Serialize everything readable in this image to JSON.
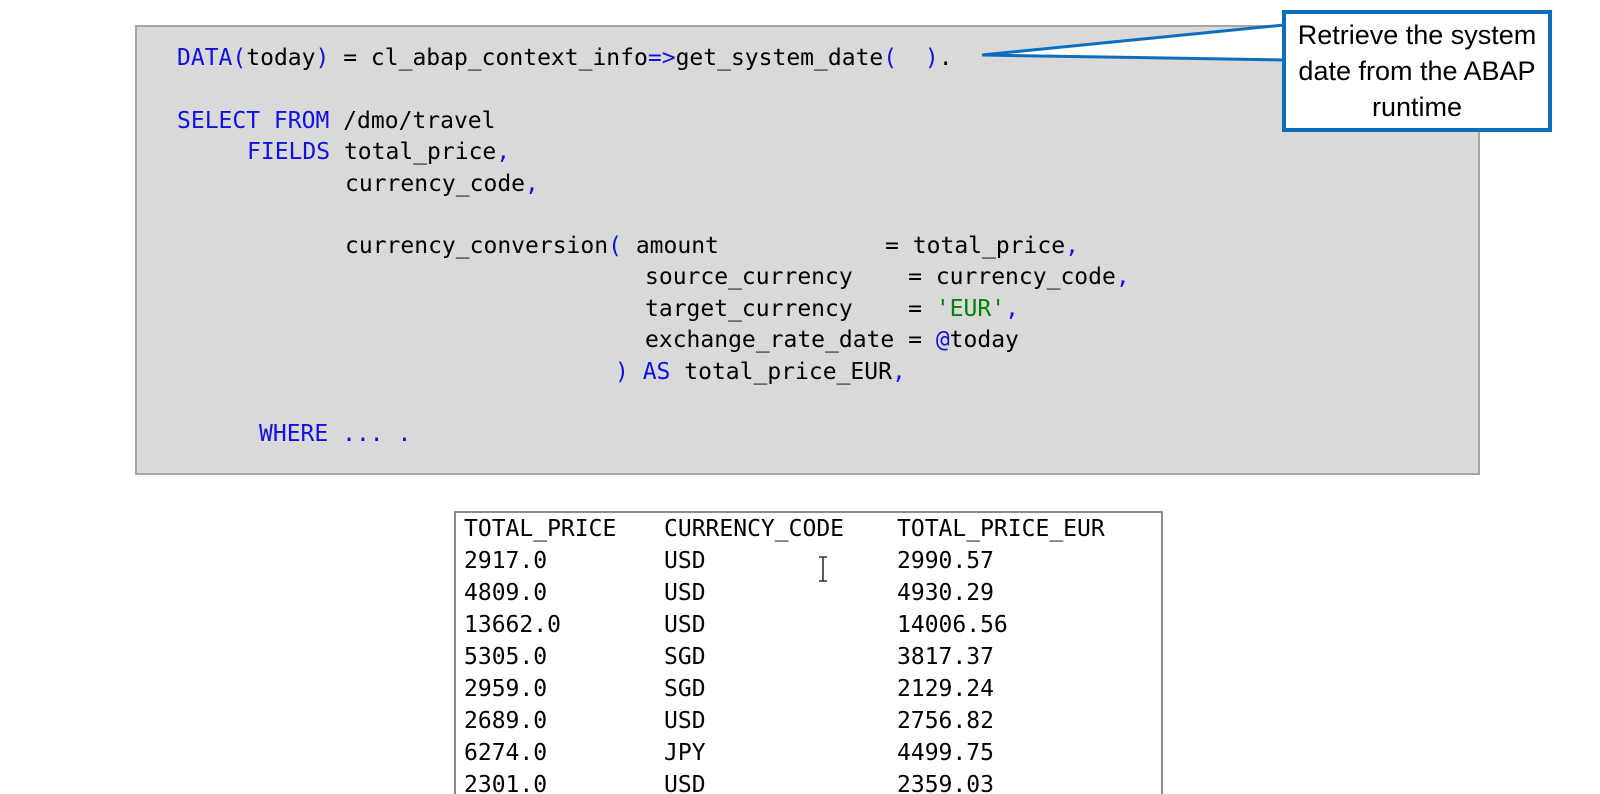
{
  "code": {
    "line_data": {
      "kw_data": "DATA(",
      "var_today": "today",
      "rest": ") = cl_abap_context_info=>get_system_date( ).",
      "call_open_kw": "",
      "call_close": ""
    },
    "line_select": {
      "kw": "SELECT FROM",
      "text": " /dmo/travel"
    },
    "line_fields": {
      "kw": "FIELDS",
      "text": " total_price",
      "comma": ","
    },
    "line_currency_code": {
      "text": "currency_code",
      "comma": ","
    },
    "line_conv": {
      "text": "currency_conversion",
      "paren": "(",
      "param": " amount            ",
      "eq": "=",
      "value": " total_price",
      "comma": ","
    },
    "line_source": {
      "param": "source_currency    ",
      "eq": "=",
      "value": " currency_code",
      "comma": ","
    },
    "line_target": {
      "param": "target_currency    ",
      "eq": "=",
      "value_pre": " ",
      "value": "'EUR'",
      "comma": ","
    },
    "line_rate": {
      "param": "exchange_rate_date ",
      "eq": "=",
      "at": " @",
      "value": "today"
    },
    "line_as": {
      "paren": ")",
      "kw": " AS",
      "value": " total_price_EUR",
      "comma": ","
    },
    "line_where": {
      "kw": "WHERE",
      "rest": " ... ."
    }
  },
  "callout": {
    "text": "Retrieve the system date from the ABAP runtime"
  },
  "result": {
    "headers": [
      "TOTAL_PRICE",
      "CURRENCY_CODE",
      "TOTAL_PRICE_EUR"
    ],
    "rows": [
      [
        "2917.0",
        "USD",
        "2990.57"
      ],
      [
        "4809.0",
        "USD",
        "4930.29"
      ],
      [
        "13662.0",
        "USD",
        "14006.56"
      ],
      [
        "5305.0",
        "SGD",
        "3817.37"
      ],
      [
        "2959.0",
        "SGD",
        "2129.24"
      ],
      [
        "2689.0",
        "USD",
        "2756.82"
      ],
      [
        "6274.0",
        "JPY",
        "4499.75"
      ],
      [
        "2301.0",
        "USD",
        "2359.03"
      ]
    ]
  },
  "colors": {
    "keyword": "#1010e0",
    "string": "#008000",
    "callout_border": "#0a6ebd",
    "code_background": "#d9d9d9"
  },
  "icons": {
    "cursor": "text-cursor-icon"
  }
}
